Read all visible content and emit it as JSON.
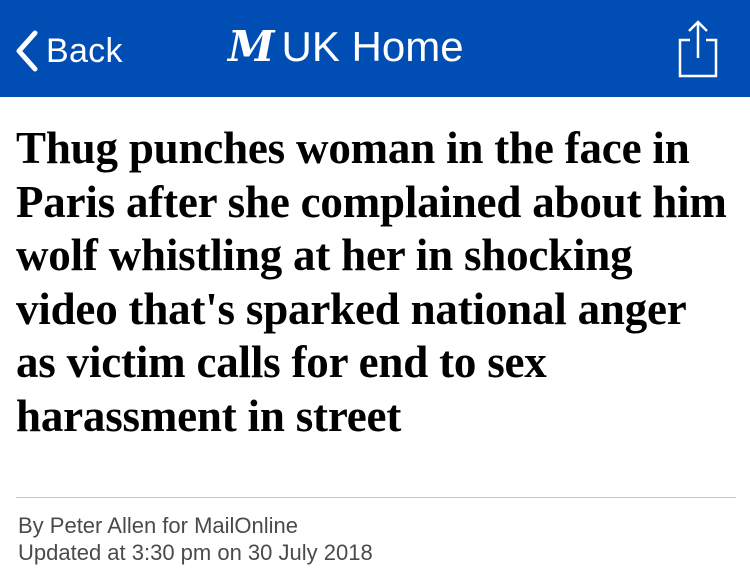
{
  "nav": {
    "back_label": "Back",
    "logo_text": "M",
    "home_label": "UK Home",
    "background_color": "#004db3",
    "icons": [
      "chevron-left-icon",
      "daily-mail-logo",
      "share-icon"
    ]
  },
  "article": {
    "headline": "Thug punches woman in the face in Paris after she complained about him wolf whistling at her in shocking video that's sparked national anger as victim calls for end to sex harassment in street",
    "byline": "By Peter Allen for MailOnline",
    "updated": "Updated at 3:30 pm on 30 July 2018"
  }
}
